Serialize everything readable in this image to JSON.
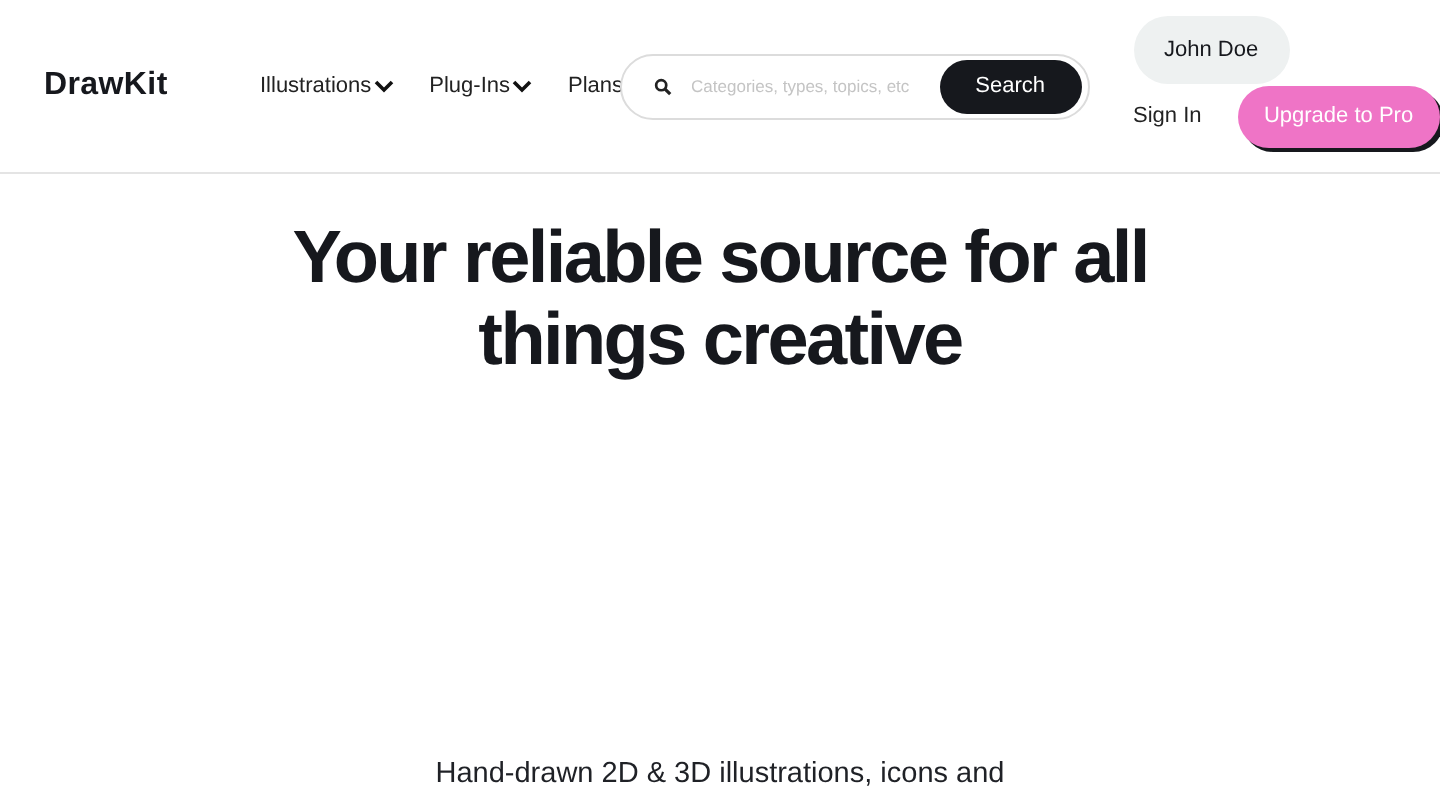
{
  "logo": "DrawKit",
  "nav": [
    {
      "label": "Illustrations",
      "dropdown": true
    },
    {
      "label": "Plug-Ins",
      "dropdown": true
    },
    {
      "label": "Plans",
      "dropdown": false
    }
  ],
  "search": {
    "placeholder": "Categories, types, topics, etc",
    "button": "Search"
  },
  "user": {
    "name": "John Doe",
    "sign_in": "Sign In",
    "upgrade": "Upgrade to Pro"
  },
  "hero": {
    "title": "Your reliable source for all things creative",
    "subtitle": "Hand-drawn 2D & 3D illustrations, icons and"
  }
}
